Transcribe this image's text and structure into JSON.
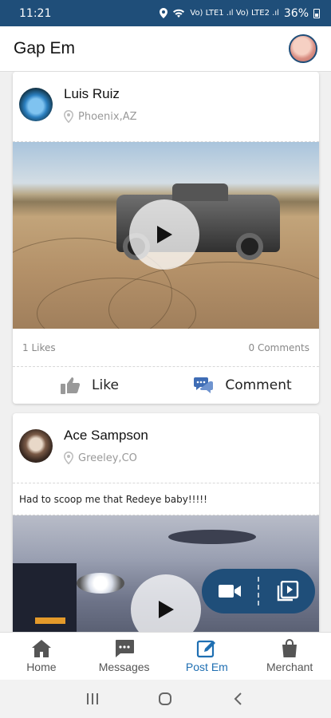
{
  "status": {
    "time": "11:21",
    "signal": "Vo) LTE1 .ıl Vo) LTE2 .ıl",
    "battery": "36%"
  },
  "header": {
    "title": "Gap Em"
  },
  "posts": [
    {
      "author": "Luis Ruiz",
      "location": "Phoenix,AZ",
      "likes": "1 Likes",
      "comments": "0 Comments",
      "like_label": "Like",
      "comment_label": "Comment"
    },
    {
      "author": "Ace Sampson",
      "location": "Greeley,CO",
      "caption": "Had to scoop me that Redeye baby!!!!!"
    }
  ],
  "nav": {
    "home": "Home",
    "messages": "Messages",
    "post": "Post Em",
    "merchant": "Merchant"
  },
  "colors": {
    "primary": "#1f4e79",
    "active": "#1f6fb2"
  },
  "icons": [
    "location-pin-icon",
    "play-icon",
    "thumbs-up-icon",
    "comment-icon",
    "video-camera-icon",
    "video-library-icon",
    "home-icon",
    "messages-icon",
    "edit-icon",
    "shopping-bag-icon"
  ]
}
